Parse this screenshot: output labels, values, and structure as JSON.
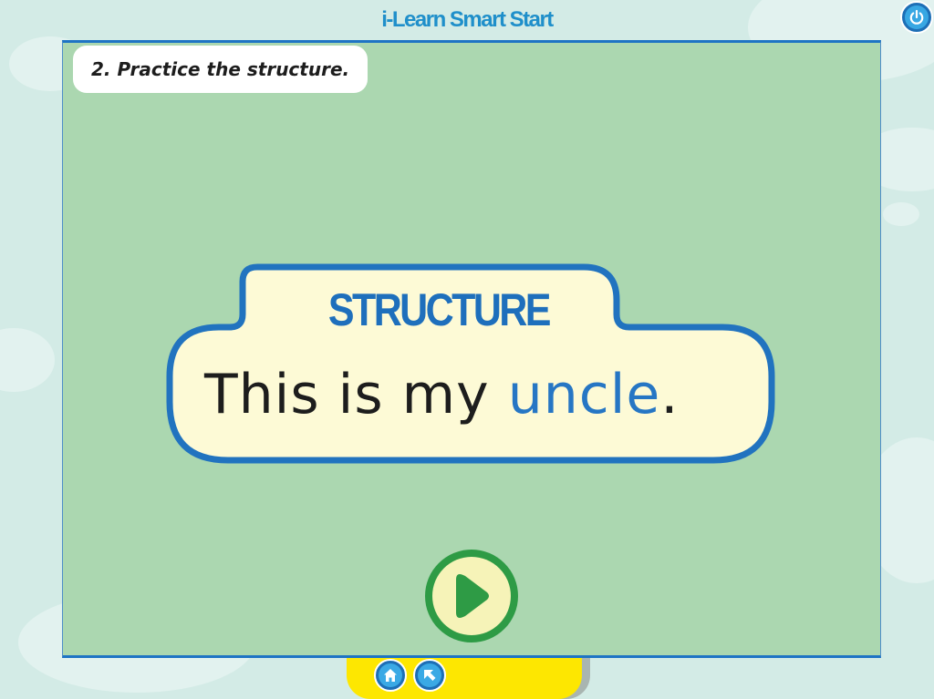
{
  "app": {
    "title": "i-Learn Smart Start"
  },
  "activity": {
    "instruction": "2. Practice the structure."
  },
  "structure": {
    "title": "STRUCTURE",
    "sentence_before": "This is my ",
    "sentence_highlight": "uncle",
    "sentence_after": "."
  },
  "icons": {
    "power": "power-icon",
    "play": "play-icon",
    "home": "home-icon",
    "back": "back-arrow-icon"
  },
  "colors": {
    "brand_blue": "#1f8fca",
    "board_green": "#abd7b0",
    "card_fill": "#fdfad6",
    "card_border": "#2173bf",
    "play_green": "#2e9b45",
    "tray_yellow": "#fde701"
  }
}
